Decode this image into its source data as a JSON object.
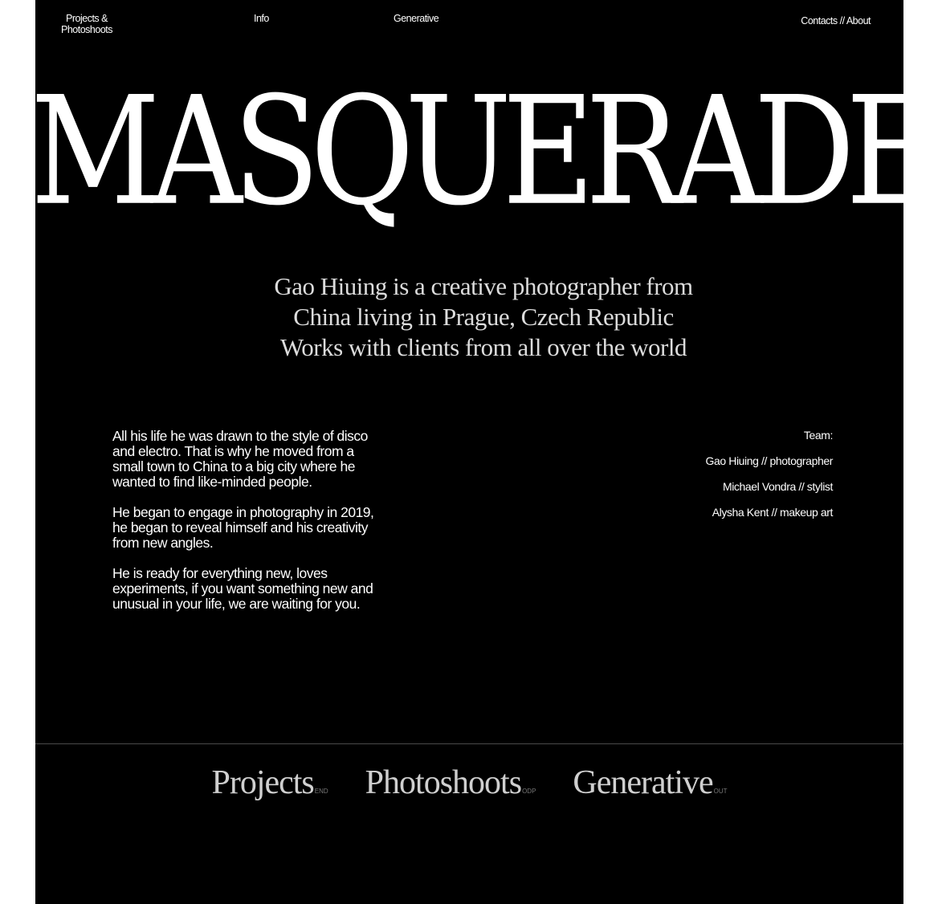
{
  "nav": {
    "projects": "Projects &\nPhotoshoots",
    "info": "Info",
    "generative": "Generative",
    "contacts": "Contacts // About"
  },
  "hero": {
    "title": "MASQUERADE"
  },
  "intro": {
    "line1": "Gao Hiuing is a creative photographer from",
    "line2": "China living in Prague, Czech Republic",
    "line3": "Works with clients from all over the world"
  },
  "bio": {
    "p1": "All his life he was drawn to the style of disco and electro. That is why he moved from a small town to China to a big city where he wanted to find like-minded people.",
    "p2": "He began to engage in photography in 2019, he began to reveal himself and his creativity from new angles.",
    "p3": "He is ready for everything new, loves experiments, if you want something new and unusual in your life, we are waiting for you."
  },
  "team": {
    "heading": "Team:",
    "members": [
      "Gao Hiuing // photographer",
      "Michael Vondra // stylist",
      "Alysha Kent // makeup art"
    ]
  },
  "footer": {
    "links": [
      {
        "label": "Projects",
        "tag": "END"
      },
      {
        "label": "Photoshoots",
        "tag": "ODP"
      },
      {
        "label": "Generative",
        "tag": "OUT"
      }
    ]
  },
  "colors": {
    "background": "#000000",
    "text": "#ffffff",
    "muted": "#777777"
  }
}
